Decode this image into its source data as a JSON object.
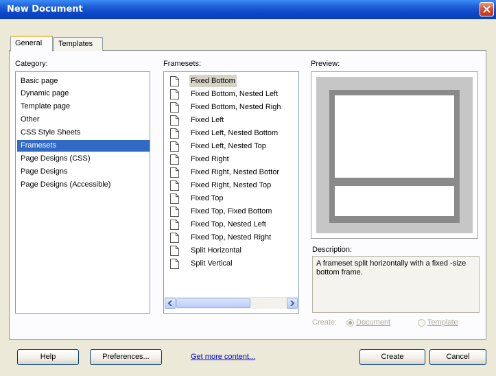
{
  "window": {
    "title": "New Document"
  },
  "tabs": [
    {
      "label": "General",
      "active": true
    },
    {
      "label": "Templates",
      "active": false
    }
  ],
  "category": {
    "label": "Category:",
    "items": [
      "Basic page",
      "Dynamic page",
      "Template page",
      "Other",
      "CSS Style Sheets",
      "Framesets",
      "Page Designs (CSS)",
      "Page Designs",
      "Page Designs (Accessible)"
    ],
    "selected": "Framesets"
  },
  "framesets": {
    "label": "Framesets:",
    "items": [
      "Fixed Bottom",
      "Fixed Bottom, Nested Left",
      "Fixed Bottom, Nested Righ",
      "Fixed Left",
      "Fixed Left, Nested Bottom",
      "Fixed Left, Nested Top",
      "Fixed Right",
      "Fixed Right, Nested Bottor",
      "Fixed Right, Nested Top",
      "Fixed Top",
      "Fixed Top, Fixed Bottom",
      "Fixed Top, Nested Left",
      "Fixed Top, Nested Right",
      "Split Horizontal",
      "Split Vertical"
    ],
    "selected": "Fixed Bottom"
  },
  "preview": {
    "label": "Preview:"
  },
  "description": {
    "label": "Description:",
    "text": "A frameset split horizontally with a fixed -size bottom frame."
  },
  "create_as": {
    "label": "Create:",
    "options": [
      "Document",
      "Template"
    ],
    "selected": "Document"
  },
  "buttons": {
    "help": "Help",
    "preferences": "Preferences...",
    "get_more": "Get more content...",
    "create": "Create",
    "cancel": "Cancel"
  },
  "icons": {
    "close": "close-icon",
    "item": "document-icon",
    "scroll_left": "chevron-left-icon",
    "scroll_right": "chevron-right-icon"
  },
  "colors": {
    "title_bar": "#0b46c8",
    "selection": "#316ac5",
    "close_button": "#d9472b",
    "link": "#0000cc"
  }
}
